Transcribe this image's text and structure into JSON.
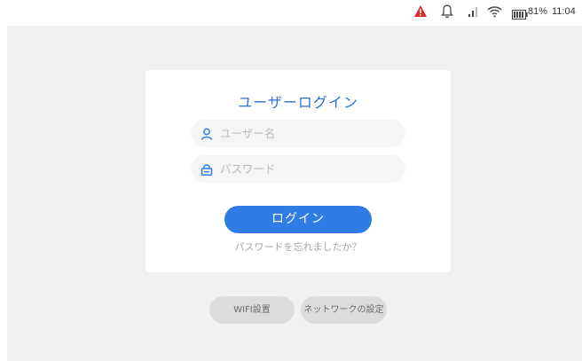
{
  "status_bar": {
    "battery_percent": "81%",
    "time": "11:04",
    "icons": [
      "alert-triangle-icon",
      "bell-icon",
      "signal-icon",
      "wifi-icon",
      "battery-icon"
    ],
    "alert_color": "#e02a2a"
  },
  "login_card": {
    "title": "ユーザーログイン",
    "username_placeholder": "ユーザー名",
    "password_placeholder": "パスワード",
    "login_button": "ログイン",
    "forgot_password": "パスワードを忘れましたか？"
  },
  "bottom_buttons": {
    "wifi_settings": "WIFI設置",
    "network_settings": "ネットワークの設定"
  },
  "colors": {
    "accent": "#2f7de4",
    "title": "#2a6fd6"
  }
}
